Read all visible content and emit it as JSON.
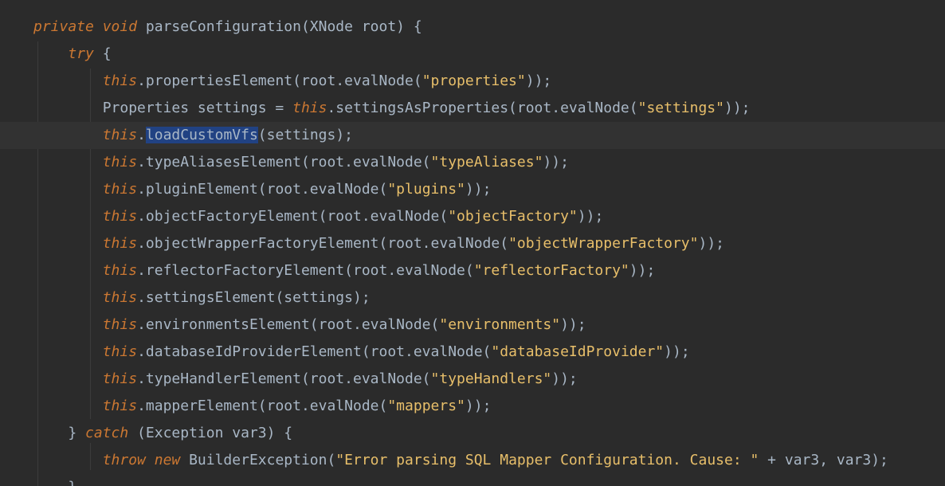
{
  "code": {
    "lines": [
      [
        {
          "t": "private",
          "c": "kw"
        },
        {
          "t": " "
        },
        {
          "t": "void",
          "c": "kw"
        },
        {
          "t": " parseConfiguration(XNode root) {"
        }
      ],
      [
        {
          "t": "    "
        },
        {
          "t": "try",
          "c": "kw"
        },
        {
          "t": " {"
        }
      ],
      [
        {
          "t": "        "
        },
        {
          "t": "this",
          "c": "kw"
        },
        {
          "t": ".propertiesElement(root.evalNode("
        },
        {
          "t": "\"properties\"",
          "c": "str"
        },
        {
          "t": "));"
        }
      ],
      [
        {
          "t": "        Properties settings = "
        },
        {
          "t": "this",
          "c": "kw"
        },
        {
          "t": ".settingsAsProperties(root.evalNode("
        },
        {
          "t": "\"settings\"",
          "c": "str"
        },
        {
          "t": "));"
        }
      ],
      [
        {
          "t": "        "
        },
        {
          "t": "this",
          "c": "kw"
        },
        {
          "t": "."
        },
        {
          "t": "loadCustomVfs",
          "c": "sel"
        },
        {
          "t": "(settings);"
        }
      ],
      [
        {
          "t": "        "
        },
        {
          "t": "this",
          "c": "kw"
        },
        {
          "t": ".typeAliasesElement(root.evalNode("
        },
        {
          "t": "\"typeAliases\"",
          "c": "str"
        },
        {
          "t": "));"
        }
      ],
      [
        {
          "t": "        "
        },
        {
          "t": "this",
          "c": "kw"
        },
        {
          "t": ".pluginElement(root.evalNode("
        },
        {
          "t": "\"plugins\"",
          "c": "str"
        },
        {
          "t": "));"
        }
      ],
      [
        {
          "t": "        "
        },
        {
          "t": "this",
          "c": "kw"
        },
        {
          "t": ".objectFactoryElement(root.evalNode("
        },
        {
          "t": "\"objectFactory\"",
          "c": "str"
        },
        {
          "t": "));"
        }
      ],
      [
        {
          "t": "        "
        },
        {
          "t": "this",
          "c": "kw"
        },
        {
          "t": ".objectWrapperFactoryElement(root.evalNode("
        },
        {
          "t": "\"objectWrapperFactory\"",
          "c": "str"
        },
        {
          "t": "));"
        }
      ],
      [
        {
          "t": "        "
        },
        {
          "t": "this",
          "c": "kw"
        },
        {
          "t": ".reflectorFactoryElement(root.evalNode("
        },
        {
          "t": "\"reflectorFactory\"",
          "c": "str"
        },
        {
          "t": "));"
        }
      ],
      [
        {
          "t": "        "
        },
        {
          "t": "this",
          "c": "kw"
        },
        {
          "t": ".settingsElement(settings);"
        }
      ],
      [
        {
          "t": "        "
        },
        {
          "t": "this",
          "c": "kw"
        },
        {
          "t": ".environmentsElement(root.evalNode("
        },
        {
          "t": "\"environments\"",
          "c": "str"
        },
        {
          "t": "));"
        }
      ],
      [
        {
          "t": "        "
        },
        {
          "t": "this",
          "c": "kw"
        },
        {
          "t": ".databaseIdProviderElement(root.evalNode("
        },
        {
          "t": "\"databaseIdProvider\"",
          "c": "str"
        },
        {
          "t": "));"
        }
      ],
      [
        {
          "t": "        "
        },
        {
          "t": "this",
          "c": "kw"
        },
        {
          "t": ".typeHandlerElement(root.evalNode("
        },
        {
          "t": "\"typeHandlers\"",
          "c": "str"
        },
        {
          "t": "));"
        }
      ],
      [
        {
          "t": "        "
        },
        {
          "t": "this",
          "c": "kw"
        },
        {
          "t": ".mapperElement(root.evalNode("
        },
        {
          "t": "\"mappers\"",
          "c": "str"
        },
        {
          "t": "));"
        }
      ],
      [
        {
          "t": "    } "
        },
        {
          "t": "catch",
          "c": "kw"
        },
        {
          "t": " (Exception var3) {"
        }
      ],
      [
        {
          "t": "        "
        },
        {
          "t": "throw",
          "c": "kw"
        },
        {
          "t": " "
        },
        {
          "t": "new",
          "c": "kw"
        },
        {
          "t": " BuilderException("
        },
        {
          "t": "\"Error parsing SQL Mapper Configuration. Cause: \"",
          "c": "str"
        },
        {
          "t": " + var3, var3);"
        }
      ],
      [
        {
          "t": "    }"
        }
      ]
    ],
    "current_line_index": 4
  },
  "colors": {
    "background": "#2b2b2b",
    "keyword": "#cc7832",
    "string": "#e8bf6a",
    "default": "#a9b7c6",
    "selection": "#214283",
    "current_line": "#323232"
  }
}
